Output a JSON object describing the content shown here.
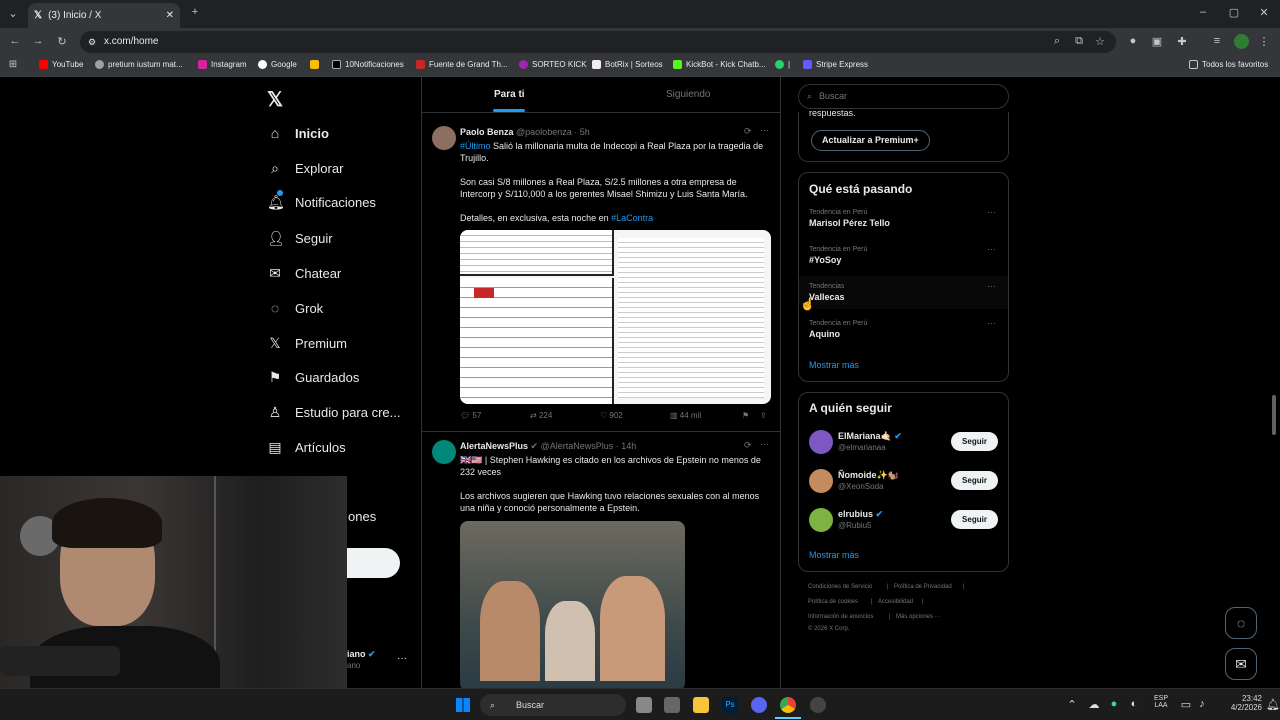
{
  "browser": {
    "tab_title": "(3) Inicio / X",
    "url": "x.com/home",
    "bookmarks": [
      "YouTube",
      "pretium iustum mat...",
      "Instagram",
      "Google",
      "",
      "10Notificaciones",
      "Fuente de Grand Th...",
      "SORTEO KICK",
      "BotRix | Sorteos",
      "KickBot - Kick Chatb...",
      "|",
      "Stripe Express"
    ],
    "bookmarks_all": "Todos los favoritos"
  },
  "nav": {
    "items": [
      {
        "label": "Inicio",
        "icon": "home-icon"
      },
      {
        "label": "Explorar",
        "icon": "search-icon"
      },
      {
        "label": "Notificaciones",
        "icon": "bell-icon"
      },
      {
        "label": "Seguir",
        "icon": "person-plus-icon"
      },
      {
        "label": "Chatear",
        "icon": "mail-icon"
      },
      {
        "label": "Grok",
        "icon": "grok-icon"
      },
      {
        "label": "Premium",
        "icon": "x-logo-icon"
      },
      {
        "label": "Guardados",
        "icon": "bookmark-icon"
      },
      {
        "label": "Estudio para cre...",
        "icon": "studio-icon"
      },
      {
        "label": "Artículos",
        "icon": "article-icon"
      }
    ],
    "more_partial": "ones",
    "profile_partial": "iano",
    "profile_handle_partial": "ano"
  },
  "feed": {
    "tabs": [
      "Para ti",
      "Siguiendo"
    ],
    "tweets": [
      {
        "name": "Paolo Benza",
        "meta": "@paolobenza · 5h",
        "hashtag": "#Último",
        "text1": " Salió la millonaria multa de Indecopi a Real Plaza por la tragedia de Trujillo.",
        "text2": "Son casi S/8 millones a Real Plaza, S/2.5 millones a otra empresa de Intercorp y S/110,000 a los gerentes Misael Shimizu y Luis Santa María.",
        "text3": "Detalles, en exclusiva, esta noche en ",
        "link": "#LaContra",
        "stats": {
          "replies": "57",
          "reposts": "224",
          "likes": "902",
          "views": "44 mil"
        }
      },
      {
        "name": "AlertaNewsPlus",
        "meta": "@AlertaNewsPlus · 14h",
        "text1": "🇬🇧🇺🇸 | Stephen Hawking es citado en los archivos de Epstein no menos de 232 veces",
        "text2": "Los archivos sugieren que Hawking tuvo relaciones sexuales con al menos una niña y conoció personalmente a Epstein."
      }
    ]
  },
  "right": {
    "search_placeholder": "Buscar",
    "partial_text": "respuestas.",
    "premium_button": "Actualizar a Premium+",
    "trending_title": "Qué está pasando",
    "trends": [
      {
        "sub": "Tendencia en Perú",
        "name": "Marisol Pérez Tello"
      },
      {
        "sub": "Tendencia en Perú",
        "name": "#YoSoy"
      },
      {
        "sub": "Tendencias",
        "name": "Vallecas"
      },
      {
        "sub": "Tendencia en Perú",
        "name": "Aquino"
      }
    ],
    "show_more": "Mostrar más",
    "follow_title": "A quién seguir",
    "follows": [
      {
        "name": "ElMariana🤙🏻",
        "handle": "@elmarianaa",
        "button": "Seguir"
      },
      {
        "name": "Ñomoide✨🐿️",
        "handle": "@XeonSoda",
        "button": "Seguir"
      },
      {
        "name": "elrubius",
        "handle": "@Rubiu5",
        "button": "Seguir"
      }
    ],
    "footer": [
      "Condiciones de Servicio",
      "|",
      "Política de Privacidad",
      "|",
      "Política de cookies",
      "|",
      "Accesibilidad",
      "|",
      "Información de anuncios",
      "|",
      "Más opciones ···",
      "© 2026 X Corp."
    ]
  },
  "taskbar": {
    "search": "Buscar",
    "lang1": "ESP",
    "lang2": "LAA",
    "time": "23:42",
    "date": "4/2/2026"
  }
}
